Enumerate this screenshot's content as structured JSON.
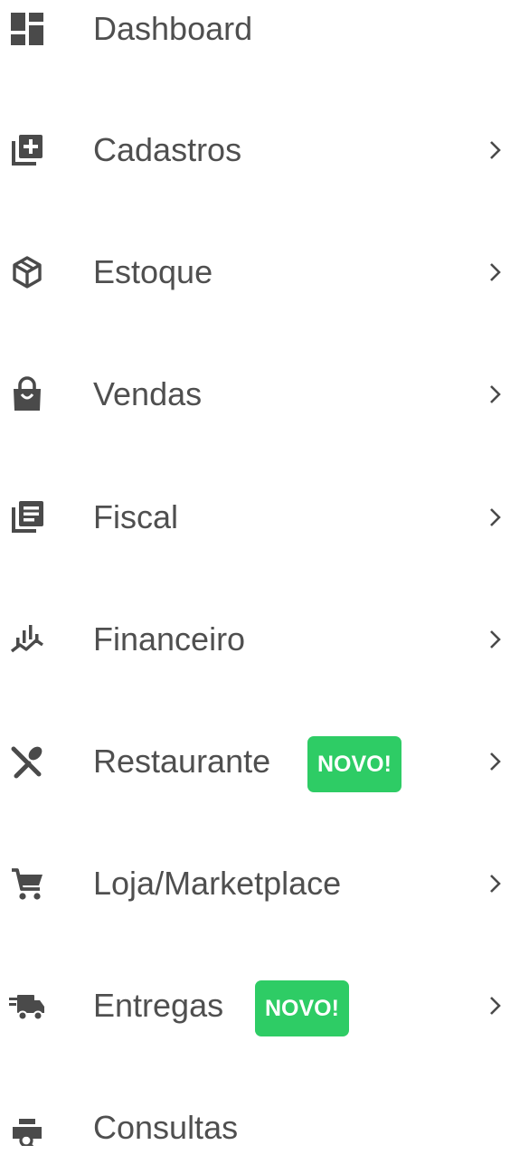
{
  "sidebar": {
    "items": [
      {
        "label": "Dashboard",
        "icon": "dashboard-icon",
        "has_submenu": false
      },
      {
        "label": "Cadastros",
        "icon": "add-box-icon",
        "has_submenu": true
      },
      {
        "label": "Estoque",
        "icon": "box-icon",
        "has_submenu": true
      },
      {
        "label": "Vendas",
        "icon": "shopping-bag-icon",
        "has_submenu": true
      },
      {
        "label": "Fiscal",
        "icon": "documents-icon",
        "has_submenu": true
      },
      {
        "label": "Financeiro",
        "icon": "finance-chart-icon",
        "has_submenu": true
      },
      {
        "label": "Restaurante",
        "icon": "restaurant-icon",
        "has_submenu": true,
        "badge": "NOVO!"
      },
      {
        "label": "Loja/Marketplace",
        "icon": "cart-icon",
        "has_submenu": true
      },
      {
        "label": "Entregas",
        "icon": "delivery-truck-icon",
        "has_submenu": true,
        "badge": "NOVO!"
      },
      {
        "label": "Consultas",
        "icon": "search-register-icon",
        "has_submenu": false
      }
    ]
  },
  "colors": {
    "icon": "#4a4a4a",
    "text": "#4f4f4f",
    "badge_bg": "#2ecc65",
    "badge_text": "#ffffff"
  }
}
